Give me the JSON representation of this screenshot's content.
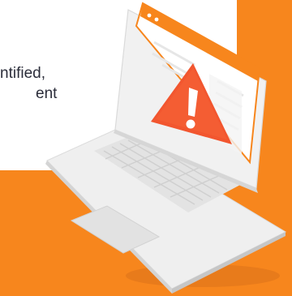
{
  "text_fragment": {
    "line1": "ntified,",
    "line2": "ent"
  },
  "colors": {
    "accent_orange": "#f7861d",
    "warning_red": "#f2562f",
    "laptop_body": "#efefef",
    "keys": "#d8d8d8",
    "heading_text": "#2b2d3a"
  },
  "icons": [
    "warning-triangle-icon",
    "laptop-illustration"
  ]
}
